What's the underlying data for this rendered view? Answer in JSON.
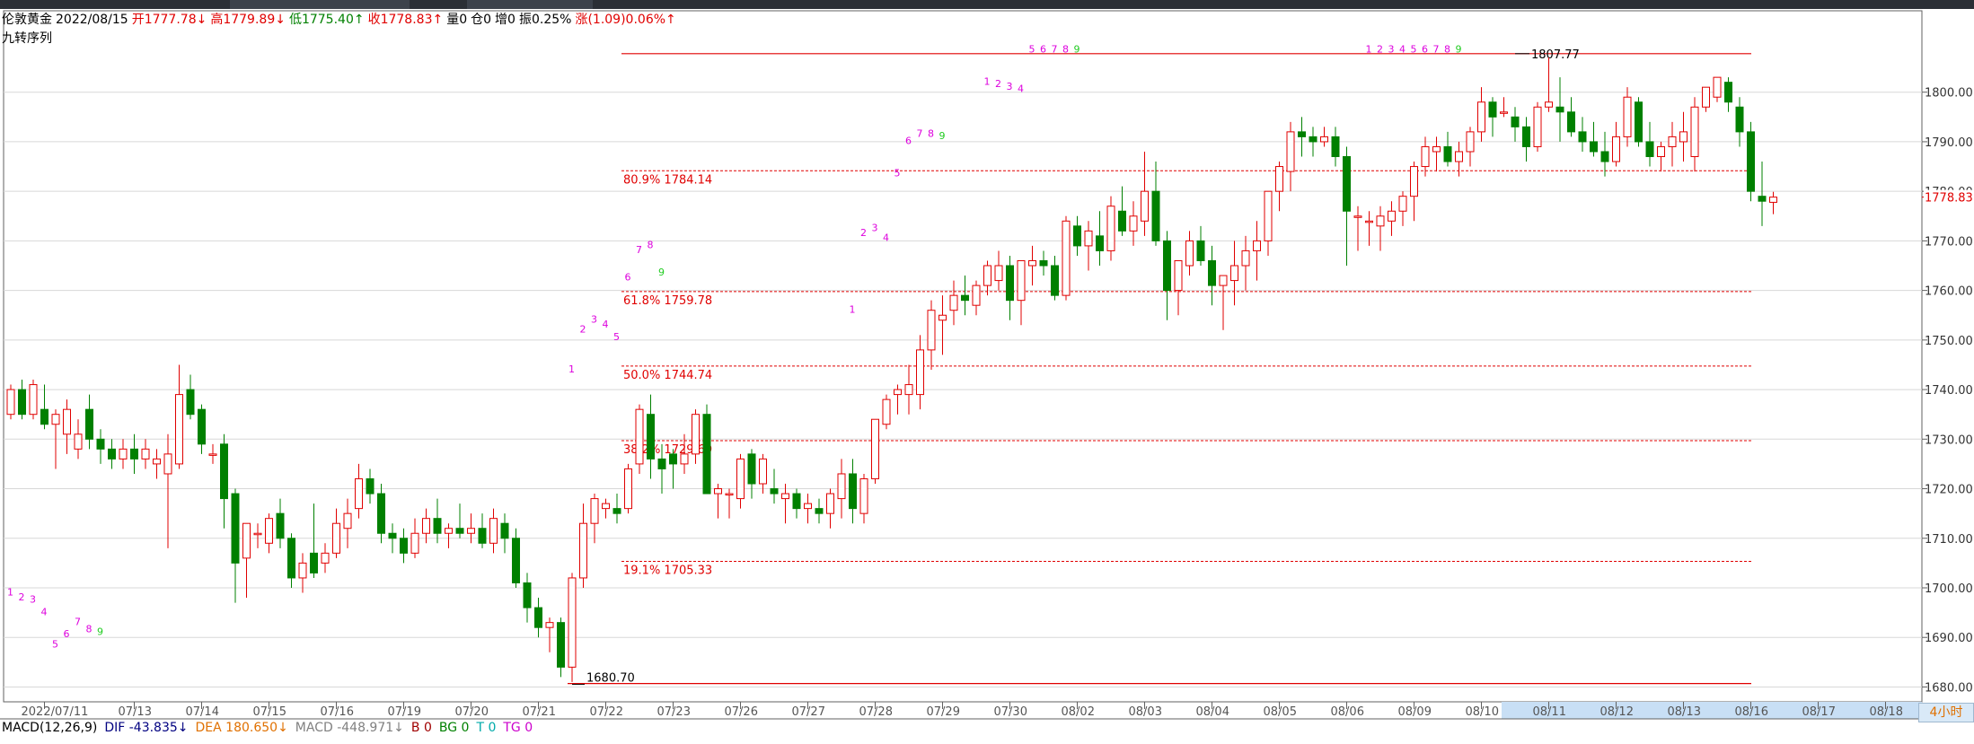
{
  "header": {
    "symbol": "伦敦黄金",
    "date": "2022/08/15",
    "open": "开1777.78↓",
    "high": "高1779.89↓",
    "low": "低1775.40↑",
    "close": "收1778.83↑",
    "volume": "量0",
    "position": "仓0",
    "increase": "增0",
    "amplitude": "振0.25%",
    "change": "涨(1.09)0.06%↑",
    "indicator_name": "九转序列"
  },
  "macd": {
    "name": "MACD(12,26,9)",
    "dif": "DIF -43.835↓",
    "dea": "DEA 180.650↓",
    "macd": "MACD -448.971↓",
    "b": "B 0",
    "bg": "BG 0",
    "t": "T 0",
    "tg": "TG 0"
  },
  "period_button": "4小时",
  "colors": {
    "up": "#e00000",
    "down": "#008000",
    "axis": "#606060",
    "grid": "#d8d8d8",
    "td_magenta": "#dd00dd",
    "td_green": "#22cc22",
    "highlight": "#c8dff5"
  },
  "chart_data": {
    "type": "candlestick",
    "ylim": [
      1678,
      1809
    ],
    "y_ticks": [
      1680,
      1690,
      1700,
      1710,
      1720,
      1730,
      1740,
      1750,
      1760,
      1770,
      1780,
      1790,
      1800
    ],
    "y_tick_labels": [
      "1680.00",
      "1690.00",
      "1700.00",
      "1710.00",
      "1720.00",
      "1730.00",
      "1740.00",
      "1750.00",
      "1760.00",
      "1770.00",
      "1780.00",
      "1790.00",
      "1800.00"
    ],
    "last_price_label": "1778.83",
    "x_labels": [
      {
        "i": 3,
        "label": "2022/07/11"
      },
      {
        "i": 11,
        "label": "07/13"
      },
      {
        "i": 17,
        "label": "07/14"
      },
      {
        "i": 23,
        "label": "07/15"
      },
      {
        "i": 29,
        "label": "07/16"
      },
      {
        "i": 35,
        "label": "07/19"
      },
      {
        "i": 41,
        "label": "07/20"
      },
      {
        "i": 47,
        "label": "07/21"
      },
      {
        "i": 53,
        "label": "07/22"
      },
      {
        "i": 59,
        "label": "07/23"
      },
      {
        "i": 65,
        "label": "07/26"
      },
      {
        "i": 71,
        "label": "07/27"
      },
      {
        "i": 77,
        "label": "07/28"
      },
      {
        "i": 83,
        "label": "07/29"
      },
      {
        "i": 89,
        "label": "07/30"
      },
      {
        "i": 95,
        "label": "08/02"
      },
      {
        "i": 101,
        "label": "08/03"
      },
      {
        "i": 107,
        "label": "08/04"
      },
      {
        "i": 113,
        "label": "08/05"
      },
      {
        "i": 119,
        "label": "08/06"
      },
      {
        "i": 125,
        "label": "08/09"
      },
      {
        "i": 131,
        "label": "08/10"
      },
      {
        "i": 137,
        "label": "08/11"
      },
      {
        "i": 143,
        "label": "08/12"
      },
      {
        "i": 149,
        "label": "08/13"
      },
      {
        "i": 155,
        "label": "08/16"
      },
      {
        "i": 161,
        "label": "08/17"
      },
      {
        "i": 167,
        "label": "08/18"
      }
    ],
    "fib_levels": [
      {
        "label": "80.9% 1784.14",
        "value": 1784.14
      },
      {
        "label": "61.8% 1759.78",
        "value": 1759.78
      },
      {
        "label": "50.0% 1744.74",
        "value": 1744.74
      },
      {
        "label": "38.2% 1729.69",
        "value": 1729.69
      },
      {
        "label": "19.1% 1705.33",
        "value": 1705.33
      }
    ],
    "range_high": {
      "label": "1807.77",
      "value": 1807.77
    },
    "range_low": {
      "label": "1680.70",
      "value": 1680.7
    },
    "candles": [
      [
        1735,
        1741,
        1734,
        1740
      ],
      [
        1740,
        1742,
        1734,
        1735
      ],
      [
        1735,
        1742,
        1734,
        1741
      ],
      [
        1736,
        1741,
        1732,
        1733
      ],
      [
        1733,
        1736,
        1724,
        1735
      ],
      [
        1731,
        1738,
        1727,
        1736
      ],
      [
        1728,
        1734,
        1726,
        1731
      ],
      [
        1736,
        1739,
        1728,
        1730
      ],
      [
        1730,
        1732,
        1725,
        1728
      ],
      [
        1728,
        1730,
        1724,
        1726
      ],
      [
        1726,
        1730,
        1724,
        1728
      ],
      [
        1728,
        1731,
        1723,
        1726
      ],
      [
        1726,
        1730,
        1724,
        1728
      ],
      [
        1725,
        1728,
        1722,
        1726
      ],
      [
        1723,
        1731,
        1708,
        1727
      ],
      [
        1725,
        1745,
        1724,
        1739
      ],
      [
        1740,
        1743,
        1734,
        1735
      ],
      [
        1736,
        1737,
        1727,
        1729
      ],
      [
        1727,
        1729,
        1725,
        1727
      ],
      [
        1729,
        1731,
        1712,
        1718
      ],
      [
        1719,
        1720,
        1697,
        1705
      ],
      [
        1706,
        1713,
        1698,
        1713
      ],
      [
        1711,
        1713,
        1708,
        1711
      ],
      [
        1709,
        1715,
        1707,
        1714
      ],
      [
        1715,
        1718,
        1708,
        1710
      ],
      [
        1710,
        1711,
        1700,
        1702
      ],
      [
        1702,
        1707,
        1699,
        1705
      ],
      [
        1707,
        1717,
        1702,
        1703
      ],
      [
        1705,
        1709,
        1703,
        1707
      ],
      [
        1707,
        1716,
        1706,
        1713
      ],
      [
        1712,
        1718,
        1708,
        1715
      ],
      [
        1716,
        1725,
        1714,
        1722
      ],
      [
        1722,
        1724,
        1717,
        1719
      ],
      [
        1719,
        1721,
        1709,
        1711
      ],
      [
        1711,
        1713,
        1707,
        1710
      ],
      [
        1710,
        1712,
        1705,
        1707
      ],
      [
        1707,
        1714,
        1706,
        1711
      ],
      [
        1711,
        1716,
        1709,
        1714
      ],
      [
        1714,
        1718,
        1709,
        1711
      ],
      [
        1711,
        1713,
        1708,
        1712
      ],
      [
        1712,
        1717,
        1710,
        1711
      ],
      [
        1711,
        1715,
        1709,
        1712
      ],
      [
        1712,
        1715,
        1708,
        1709
      ],
      [
        1709,
        1716,
        1707,
        1714
      ],
      [
        1713,
        1715,
        1707,
        1710
      ],
      [
        1710,
        1712,
        1700,
        1701
      ],
      [
        1701,
        1703,
        1693,
        1696
      ],
      [
        1696,
        1698,
        1690,
        1692
      ],
      [
        1692,
        1694,
        1687,
        1693
      ],
      [
        1693,
        1694,
        1682,
        1684
      ],
      [
        1684,
        1703,
        1681,
        1702
      ],
      [
        1702,
        1717,
        1700,
        1713
      ],
      [
        1713,
        1719,
        1709,
        1718
      ],
      [
        1716,
        1718,
        1714,
        1717
      ],
      [
        1716,
        1719,
        1713,
        1715
      ],
      [
        1716,
        1725,
        1715,
        1724
      ],
      [
        1725,
        1737,
        1723,
        1736
      ],
      [
        1735,
        1739,
        1722,
        1726
      ],
      [
        1726,
        1729,
        1719,
        1724
      ],
      [
        1727,
        1728,
        1720,
        1725
      ],
      [
        1725,
        1731,
        1723,
        1727
      ],
      [
        1727,
        1736,
        1725,
        1735
      ],
      [
        1735,
        1737,
        1719,
        1719
      ],
      [
        1719,
        1721,
        1714,
        1720
      ],
      [
        1719,
        1720,
        1714,
        1719
      ],
      [
        1718,
        1727,
        1716,
        1726
      ],
      [
        1727,
        1728,
        1718,
        1721
      ],
      [
        1721,
        1727,
        1719,
        1726
      ],
      [
        1720,
        1724,
        1717,
        1719
      ],
      [
        1718,
        1721,
        1713,
        1719
      ],
      [
        1719,
        1720,
        1714,
        1716
      ],
      [
        1716,
        1719,
        1713,
        1717
      ],
      [
        1716,
        1718,
        1713,
        1715
      ],
      [
        1715,
        1720,
        1712,
        1719
      ],
      [
        1718,
        1726,
        1714,
        1723
      ],
      [
        1723,
        1726,
        1713,
        1716
      ],
      [
        1715,
        1723,
        1713,
        1722
      ],
      [
        1722,
        1734,
        1721,
        1734
      ],
      [
        1733,
        1739,
        1732,
        1738
      ],
      [
        1739,
        1741,
        1735,
        1740
      ],
      [
        1739,
        1745,
        1735,
        1741
      ],
      [
        1739,
        1751,
        1736,
        1748
      ],
      [
        1748,
        1758,
        1744,
        1756
      ],
      [
        1754,
        1759,
        1747,
        1755
      ],
      [
        1756,
        1762,
        1753,
        1759
      ],
      [
        1759,
        1763,
        1755,
        1758
      ],
      [
        1757,
        1762,
        1755,
        1761
      ],
      [
        1761,
        1766,
        1759,
        1765
      ],
      [
        1762,
        1768,
        1760,
        1765
      ],
      [
        1765,
        1767,
        1754,
        1758
      ],
      [
        1758,
        1766,
        1753,
        1766
      ],
      [
        1765,
        1769,
        1761,
        1766
      ],
      [
        1766,
        1768,
        1763,
        1765
      ],
      [
        1765,
        1767,
        1758,
        1759
      ],
      [
        1759,
        1775,
        1758,
        1774
      ],
      [
        1773,
        1775,
        1767,
        1769
      ],
      [
        1769,
        1774,
        1764,
        1772
      ],
      [
        1771,
        1776,
        1765,
        1768
      ],
      [
        1768,
        1779,
        1766,
        1777
      ],
      [
        1776,
        1781,
        1771,
        1772
      ],
      [
        1772,
        1778,
        1769,
        1775
      ],
      [
        1774,
        1788,
        1771,
        1780
      ],
      [
        1780,
        1786,
        1769,
        1770
      ],
      [
        1770,
        1772,
        1754,
        1760
      ],
      [
        1760,
        1765,
        1755,
        1766
      ],
      [
        1765,
        1772,
        1763,
        1770
      ],
      [
        1770,
        1773,
        1765,
        1766
      ],
      [
        1766,
        1769,
        1757,
        1761
      ],
      [
        1761,
        1763,
        1752,
        1763
      ],
      [
        1762,
        1770,
        1757,
        1765
      ],
      [
        1765,
        1771,
        1760,
        1768
      ],
      [
        1768,
        1774,
        1762,
        1770
      ],
      [
        1770,
        1778,
        1767,
        1780
      ],
      [
        1780,
        1786,
        1776,
        1785
      ],
      [
        1784,
        1794,
        1780,
        1792
      ],
      [
        1792,
        1795,
        1787,
        1791
      ],
      [
        1791,
        1793,
        1787,
        1790
      ],
      [
        1790,
        1793,
        1789,
        1791
      ],
      [
        1791,
        1793,
        1785,
        1787
      ],
      [
        1787,
        1789,
        1765,
        1776
      ],
      [
        1775,
        1777,
        1768,
        1775
      ],
      [
        1774,
        1776,
        1769,
        1774
      ],
      [
        1773,
        1777,
        1768,
        1775
      ],
      [
        1774,
        1778,
        1771,
        1776
      ],
      [
        1776,
        1780,
        1773,
        1779
      ],
      [
        1779,
        1786,
        1774,
        1785
      ],
      [
        1785,
        1791,
        1783,
        1789
      ],
      [
        1788,
        1791,
        1784,
        1789
      ],
      [
        1789,
        1792,
        1785,
        1786
      ],
      [
        1786,
        1790,
        1783,
        1788
      ],
      [
        1788,
        1793,
        1785,
        1792
      ],
      [
        1792,
        1801,
        1790,
        1798
      ],
      [
        1798,
        1799,
        1791,
        1795
      ],
      [
        1796,
        1799,
        1795,
        1796
      ],
      [
        1795,
        1797,
        1790,
        1793
      ],
      [
        1793,
        1795,
        1786,
        1789
      ],
      [
        1789,
        1798,
        1788,
        1797
      ],
      [
        1797,
        1807,
        1796,
        1798
      ],
      [
        1797,
        1803,
        1790,
        1796
      ],
      [
        1796,
        1799,
        1791,
        1792
      ],
      [
        1792,
        1795,
        1788,
        1790
      ],
      [
        1790,
        1794,
        1787,
        1788
      ],
      [
        1788,
        1792,
        1783,
        1786
      ],
      [
        1786,
        1794,
        1785,
        1791
      ],
      [
        1791,
        1801,
        1789,
        1799
      ],
      [
        1798,
        1799,
        1789,
        1790
      ],
      [
        1790,
        1794,
        1785,
        1787
      ],
      [
        1787,
        1790,
        1784,
        1789
      ],
      [
        1789,
        1794,
        1785,
        1791
      ],
      [
        1790,
        1796,
        1786,
        1792
      ],
      [
        1787,
        1799,
        1784,
        1797
      ],
      [
        1797,
        1801,
        1796,
        1801
      ],
      [
        1799,
        1803,
        1798,
        1803
      ],
      [
        1802,
        1803,
        1796,
        1798
      ],
      [
        1797,
        1799,
        1789,
        1792
      ],
      [
        1792,
        1794,
        1778,
        1780
      ],
      [
        1779,
        1786,
        1773,
        1778
      ],
      [
        1777.78,
        1779.89,
        1775.4,
        1778.83
      ]
    ],
    "td_markers": [
      {
        "i": 0,
        "t": "1",
        "v": 1698.5
      },
      {
        "i": 1,
        "t": "2",
        "v": 1697.5
      },
      {
        "i": 2,
        "t": "3",
        "v": 1697
      },
      {
        "i": 3,
        "t": "4",
        "v": 1694.5
      },
      {
        "i": 4,
        "t": "5",
        "v": 1688
      },
      {
        "i": 5,
        "t": "6",
        "v": 1690
      },
      {
        "i": 6,
        "t": "7",
        "v": 1692.5
      },
      {
        "i": 7,
        "t": "8",
        "v": 1691
      },
      {
        "i": 8,
        "t": "9",
        "v": 1690.5
      },
      {
        "i": 50,
        "t": "1",
        "v": 1743.5
      },
      {
        "i": 51,
        "t": "2",
        "v": 1751.5
      },
      {
        "i": 52,
        "t": "3",
        "v": 1753.5
      },
      {
        "i": 53,
        "t": "4",
        "v": 1752.5
      },
      {
        "i": 54,
        "t": "5",
        "v": 1750
      },
      {
        "i": 55,
        "t": "6",
        "v": 1762
      },
      {
        "i": 56,
        "t": "7",
        "v": 1767.5
      },
      {
        "i": 57,
        "t": "8",
        "v": 1768.5
      },
      {
        "i": 58,
        "t": "9",
        "v": 1763
      },
      {
        "i": 75,
        "t": "1",
        "v": 1755.5
      },
      {
        "i": 76,
        "t": "2",
        "v": 1771
      },
      {
        "i": 77,
        "t": "3",
        "v": 1772
      },
      {
        "i": 78,
        "t": "4",
        "v": 1770
      },
      {
        "i": 79,
        "t": "5",
        "v": 1783
      },
      {
        "i": 80,
        "t": "6",
        "v": 1789.5
      },
      {
        "i": 81,
        "t": "7",
        "v": 1791
      },
      {
        "i": 82,
        "t": "8",
        "v": 1791
      },
      {
        "i": 83,
        "t": "9",
        "v": 1790.5
      },
      {
        "i": 87,
        "t": "1",
        "v": 1801.5
      },
      {
        "i": 88,
        "t": "2",
        "v": 1801
      },
      {
        "i": 89,
        "t": "3",
        "v": 1800.5
      },
      {
        "i": 90,
        "t": "4",
        "v": 1800
      },
      {
        "i": 91,
        "t": "5",
        "v": 1808
      },
      {
        "i": 92,
        "t": "6",
        "v": 1808
      },
      {
        "i": 93,
        "t": "7",
        "v": 1808
      },
      {
        "i": 94,
        "t": "8",
        "v": 1808
      },
      {
        "i": 95,
        "t": "9",
        "v": 1808
      },
      {
        "i": 121,
        "t": "1",
        "v": 1808
      },
      {
        "i": 122,
        "t": "2",
        "v": 1808
      },
      {
        "i": 123,
        "t": "3",
        "v": 1808
      },
      {
        "i": 124,
        "t": "4",
        "v": 1808
      },
      {
        "i": 125,
        "t": "5",
        "v": 1808
      },
      {
        "i": 126,
        "t": "6",
        "v": 1808
      },
      {
        "i": 127,
        "t": "7",
        "v": 1808
      },
      {
        "i": 128,
        "t": "8",
        "v": 1808
      },
      {
        "i": 129,
        "t": "9",
        "v": 1808
      }
    ]
  }
}
